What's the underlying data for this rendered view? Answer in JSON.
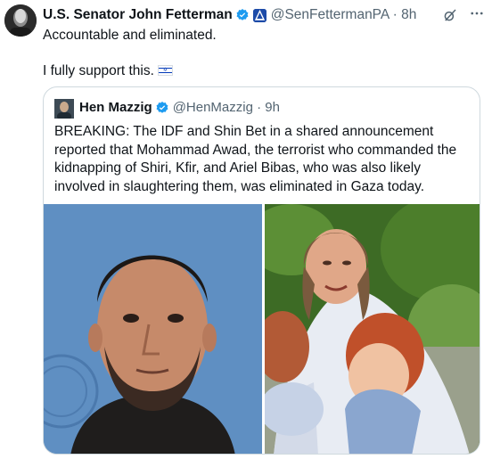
{
  "tweet": {
    "author_name": "U.S. Senator John Fetterman",
    "author_handle": "@SenFettermanPA",
    "separator": "·",
    "time": "8h",
    "verified_icon": "verified-badge-icon",
    "government_badge_icon": "government-badge-icon",
    "lines": [
      "Accountable and eliminated.",
      "I fully support this."
    ],
    "flag_icon": "israel-flag-emoji"
  },
  "quoted_tweet": {
    "author_name": "Hen Mazzig",
    "author_handle": "@HenMazzig",
    "separator": "·",
    "time": "9h",
    "text": "BREAKING: The IDF and Shin Bet in a shared announcement reported that Mohammad Awad, the terrorist who commanded the kidnapping of Shiri, Kfir, and Ariel Bibas, who was also likely involved in slaughtering them, was eliminated in Gaza today."
  },
  "icons": {
    "grok": "grok-icon",
    "more": "more-options-icon"
  },
  "colors": {
    "verified": "#1d9bf0",
    "gov_badge": "#1d4ba8",
    "secondary_text": "#536471",
    "border": "#cfd9de"
  }
}
